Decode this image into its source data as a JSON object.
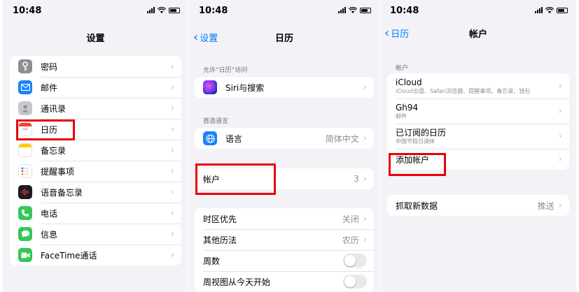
{
  "status_time": "10:48",
  "screen1": {
    "title": "设置",
    "items": [
      {
        "label": "密码",
        "icon": "key-icon",
        "color": "#8e8e93"
      },
      {
        "label": "邮件",
        "icon": "mail-icon",
        "color": "#1a82fb"
      },
      {
        "label": "通讯录",
        "icon": "contacts-icon",
        "color": "#a7a7ab"
      },
      {
        "label": "日历",
        "icon": "calendar-icon",
        "color": "#ff3b30"
      },
      {
        "label": "备忘录",
        "icon": "notes-icon",
        "color": "#ffcc00"
      },
      {
        "label": "提醒事项",
        "icon": "reminders-icon",
        "color": "#ff9500"
      },
      {
        "label": "语音备忘录",
        "icon": "voice-memos-icon",
        "color": "#1c1c1e"
      },
      {
        "label": "电话",
        "icon": "phone-icon",
        "color": "#34c759"
      },
      {
        "label": "信息",
        "icon": "messages-icon",
        "color": "#34c759"
      },
      {
        "label": "FaceTime通话",
        "icon": "facetime-icon",
        "color": "#34c759"
      }
    ]
  },
  "screen2": {
    "back": "设置",
    "title": "日历",
    "sec_access": "允许“日历”访问",
    "siri": "Siri与搜索",
    "sec_lang": "首选语言",
    "language": "语言",
    "language_value": "简体中文",
    "accounts": "帐户",
    "accounts_count": "3",
    "timezone": "时区优先",
    "timezone_value": "关闭",
    "alt_calendar": "其他历法",
    "alt_calendar_value": "农历",
    "week_numbers": "周数",
    "week_start": "周视图从今天开始"
  },
  "screen3": {
    "back": "日历",
    "title": "帐户",
    "sec_accounts": "帐户",
    "accounts": [
      {
        "name": "iCloud",
        "detail": "iCloud云盘、Safari浏览器、提醒事项、备忘录、钱包"
      },
      {
        "name": "Gh94",
        "detail": "邮件"
      },
      {
        "name": "已订阅的日历",
        "detail": "中国节假日调休"
      }
    ],
    "add_account": "添加帐户",
    "fetch": "抓取新数据",
    "fetch_value": "推送"
  },
  "colors": {
    "highlight": "#e8000b",
    "link": "#007aff"
  }
}
